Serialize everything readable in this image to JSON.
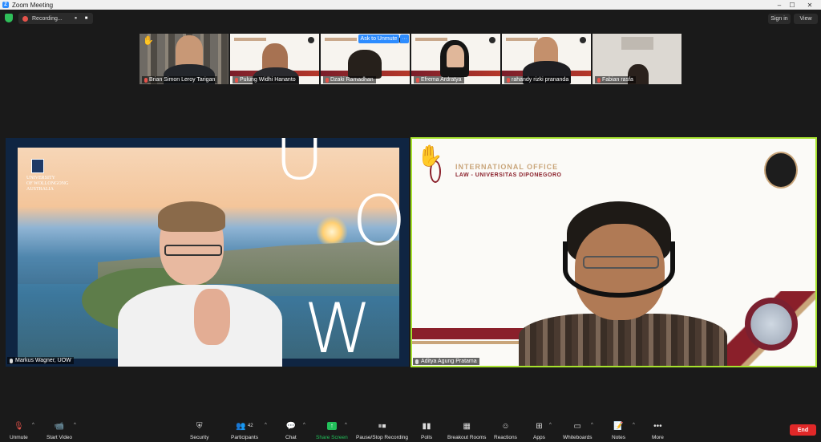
{
  "window": {
    "title": "Zoom Meeting",
    "minimize": "–",
    "maximize": "☐",
    "close": "✕"
  },
  "recording": {
    "label": "Recording...",
    "pause": "⏸",
    "stop": "■"
  },
  "top_right": {
    "sign_in": "Sign in",
    "view": "View"
  },
  "ask_to_unmute": {
    "label": "Ask to Unmute",
    "more": "···"
  },
  "thumbnails": [
    {
      "name": "Brian Simon Leroy Tarigan"
    },
    {
      "name": "Pulung Widhi Hananto"
    },
    {
      "name": "Dzaki Ramadhan"
    },
    {
      "name": "Efrema Ardratya"
    },
    {
      "name": "rahandy rizki prananda"
    },
    {
      "name": "Fabian rasfa"
    }
  ],
  "main_left": {
    "name": "Markus Wagner, UOW",
    "logo_line1": "UNIVERSITY",
    "logo_line2": "OF WOLLONGONG",
    "logo_line3": "AUSTRALIA",
    "letter_u": "U",
    "letter_o": "O",
    "letter_w": "W"
  },
  "main_right": {
    "name": "Aditya Agung Pratama",
    "org_title": "INTERNATIONAL OFFICE",
    "org_sub": "LAW - UNIVERSITAS DIPONEGORO",
    "raise_hand": "✋"
  },
  "toolbar": {
    "unmute": "Unmute",
    "start_video": "Start Video",
    "security": "Security",
    "participants": "Participants",
    "participants_count": "42",
    "chat": "Chat",
    "share_screen": "Share Screen",
    "pause_stop_recording": "Pause/Stop Recording",
    "polls": "Polls",
    "breakout_rooms": "Breakout Rooms",
    "reactions": "Reactions",
    "apps": "Apps",
    "whiteboards": "Whiteboards",
    "notes": "Notes",
    "more": "More",
    "end": "End",
    "caret": "^"
  },
  "colors": {
    "accent": "#2d8cff",
    "active_speaker_border": "#a6e22e",
    "end": "#e02828",
    "share": "#22c05a"
  }
}
